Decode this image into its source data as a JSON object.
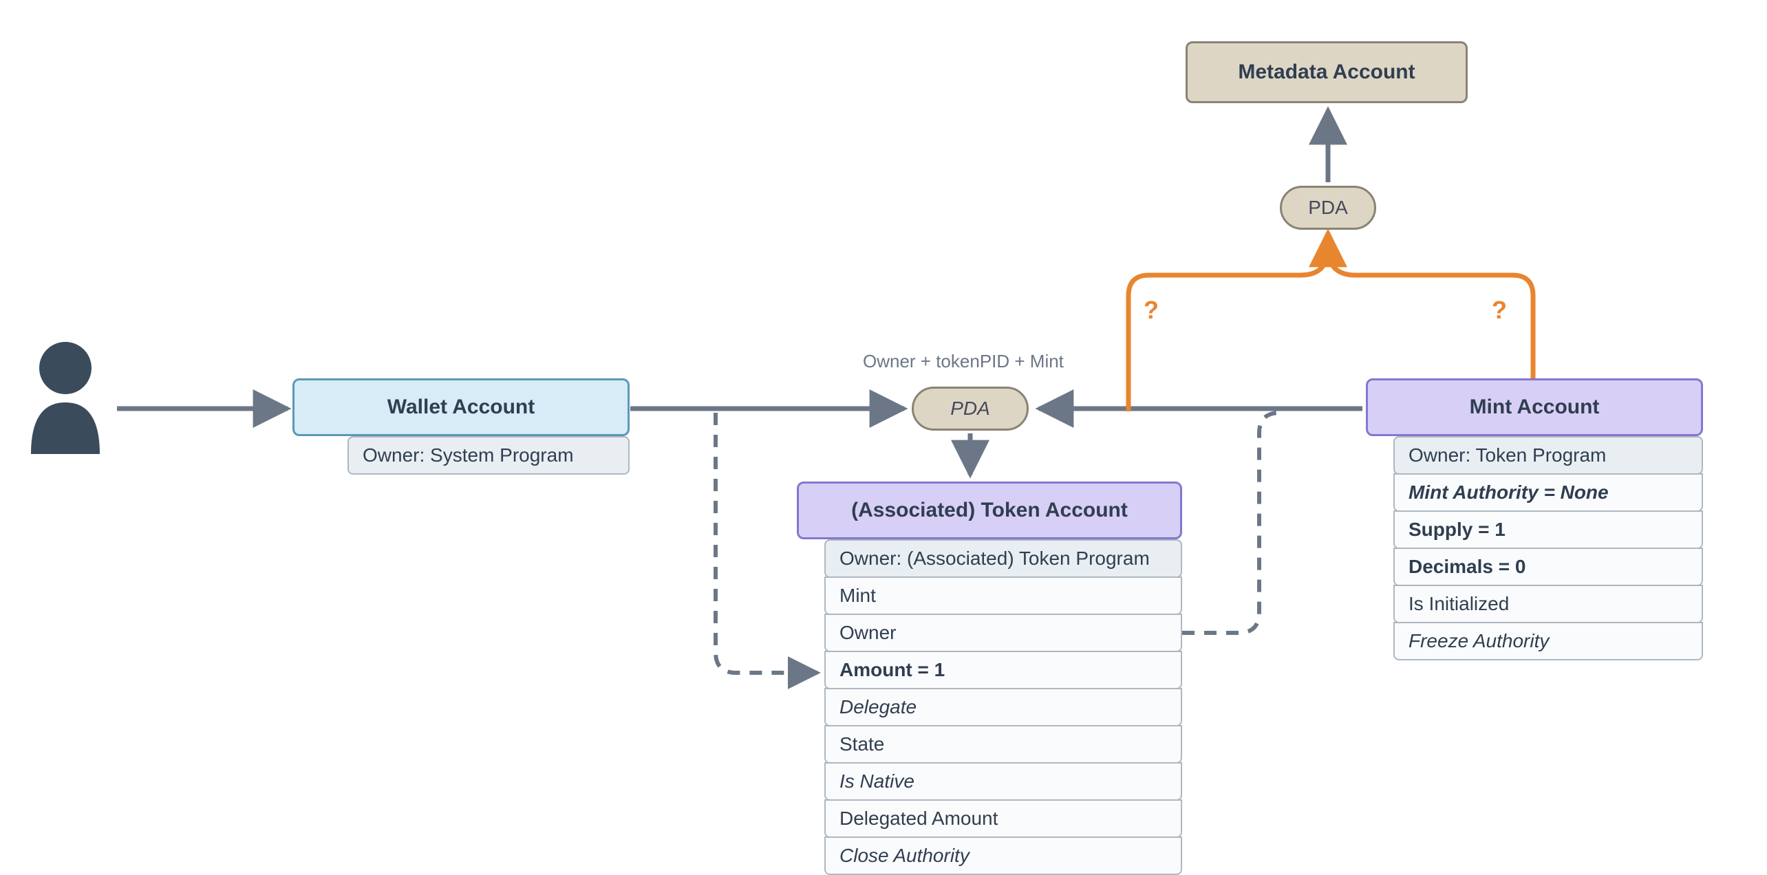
{
  "nodes": {
    "metadata": {
      "label": "Metadata Account"
    },
    "pda_top": {
      "label": "PDA"
    },
    "wallet": {
      "label": "Wallet Account",
      "owner": "Owner: System Program"
    },
    "pda_mid": {
      "label": "PDA",
      "hint": "Owner + tokenPID + Mint"
    },
    "token": {
      "label": "(Associated) Token Account",
      "owner": "Owner: (Associated) Token Program",
      "rows": [
        {
          "text": "Mint",
          "style": ""
        },
        {
          "text": "Owner",
          "style": ""
        },
        {
          "text": "Amount = 1",
          "style": "bold"
        },
        {
          "text": "Delegate",
          "style": "italic"
        },
        {
          "text": "State",
          "style": ""
        },
        {
          "text": "Is Native",
          "style": "italic"
        },
        {
          "text": "Delegated Amount",
          "style": ""
        },
        {
          "text": "Close Authority",
          "style": "italic"
        }
      ]
    },
    "mint": {
      "label": "Mint Account",
      "owner": "Owner: Token Program",
      "rows": [
        {
          "text": "Mint Authority = None",
          "style": "bolditalic"
        },
        {
          "text": "Supply = 1",
          "style": "bold"
        },
        {
          "text": "Decimals = 0",
          "style": "bold"
        },
        {
          "text": "Is Initialized",
          "style": ""
        },
        {
          "text": "Freeze Authority",
          "style": "italic"
        }
      ]
    }
  },
  "questions": {
    "left": "?",
    "right": "?"
  }
}
